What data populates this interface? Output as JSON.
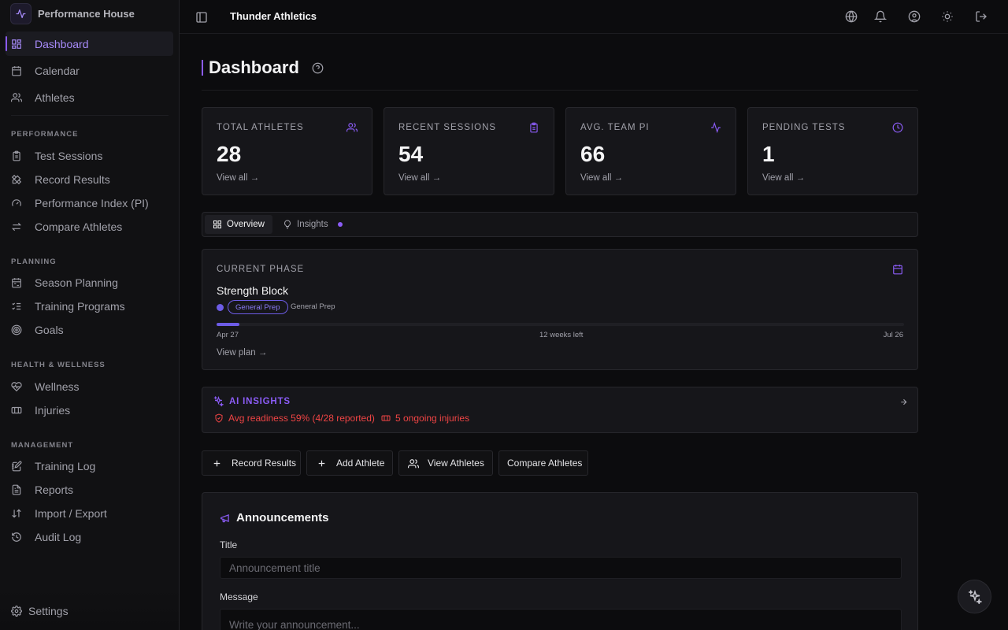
{
  "brand": {
    "name": "Performance House",
    "logo_icon": "activity-icon"
  },
  "header": {
    "org_name": "Thunder Athletics"
  },
  "sidebar": {
    "main_items": [
      {
        "label": "Dashboard",
        "icon": "layout-grid-icon",
        "active": true
      },
      {
        "label": "Calendar",
        "icon": "calendar-icon"
      },
      {
        "label": "Athletes",
        "icon": "users-icon"
      }
    ],
    "sections": [
      {
        "title": "PERFORMANCE",
        "items": [
          {
            "label": "Test Sessions",
            "icon": "clipboard-icon"
          },
          {
            "label": "Record Results",
            "icon": "pencil-ruler-icon"
          },
          {
            "label": "Performance Index (PI)",
            "icon": "gauge-icon"
          },
          {
            "label": "Compare Athletes",
            "icon": "arrows-compare-icon"
          }
        ]
      },
      {
        "title": "PLANNING",
        "items": [
          {
            "label": "Season Planning",
            "icon": "calendar-range-icon"
          },
          {
            "label": "Training Programs",
            "icon": "list-checks-icon"
          },
          {
            "label": "Goals",
            "icon": "target-icon"
          }
        ]
      },
      {
        "title": "HEALTH & WELLNESS",
        "items": [
          {
            "label": "Wellness",
            "icon": "heart-pulse-icon"
          },
          {
            "label": "Injuries",
            "icon": "bandage-icon"
          }
        ]
      },
      {
        "title": "MANAGEMENT",
        "items": [
          {
            "label": "Training Log",
            "icon": "notebook-pen-icon"
          },
          {
            "label": "Reports",
            "icon": "file-text-icon"
          },
          {
            "label": "Import / Export",
            "icon": "arrow-up-down-icon"
          },
          {
            "label": "Audit Log",
            "icon": "history-icon"
          }
        ]
      }
    ],
    "settings_label": "Settings"
  },
  "page": {
    "title": "Dashboard"
  },
  "stats": [
    {
      "label": "TOTAL ATHLETES",
      "value": "28",
      "link": "View all →",
      "icon": "users-icon"
    },
    {
      "label": "RECENT SESSIONS",
      "value": "54",
      "link": "View all →",
      "icon": "clipboard-icon"
    },
    {
      "label": "AVG. TEAM PI",
      "value": "66",
      "link": "View all →",
      "icon": "activity-icon"
    },
    {
      "label": "PENDING TESTS",
      "value": "1",
      "link": "View all →",
      "icon": "clock-icon"
    }
  ],
  "tabs": [
    {
      "label": "Overview",
      "active": true,
      "icon": "layout-grid-icon"
    },
    {
      "label": "Insights",
      "active": false,
      "icon": "lightbulb-icon"
    }
  ],
  "phase": {
    "label": "CURRENT PHASE",
    "name": "Strength Block",
    "badge": "General Prep",
    "subtype": "General Prep",
    "start": "Apr 27",
    "remaining": "12 weeks left",
    "end": "Jul 26",
    "progress_pct": 3.3,
    "link": "View plan →"
  },
  "ai_insights": {
    "title": "AI INSIGHTS",
    "items": [
      {
        "text": "Avg readiness 59% (4/28 reported)",
        "icon": "shield-alert-icon"
      },
      {
        "text": "5 ongoing injuries",
        "icon": "bandage-icon"
      }
    ]
  },
  "actions": [
    {
      "label": "Record Results",
      "icon": "plus-icon"
    },
    {
      "label": "Add Athlete",
      "icon": "plus-icon"
    },
    {
      "label": "View Athletes",
      "icon": "users-icon"
    },
    {
      "label": "Compare Athletes",
      "icon": ""
    }
  ],
  "announcements": {
    "title": "Announcements",
    "title_label": "Title",
    "title_placeholder": "Announcement title",
    "message_label": "Message",
    "message_placeholder": "Write your announcement..."
  },
  "colors": {
    "accent": "#8b5cf6",
    "danger": "#ef4444",
    "background": "#0c0c0e"
  }
}
